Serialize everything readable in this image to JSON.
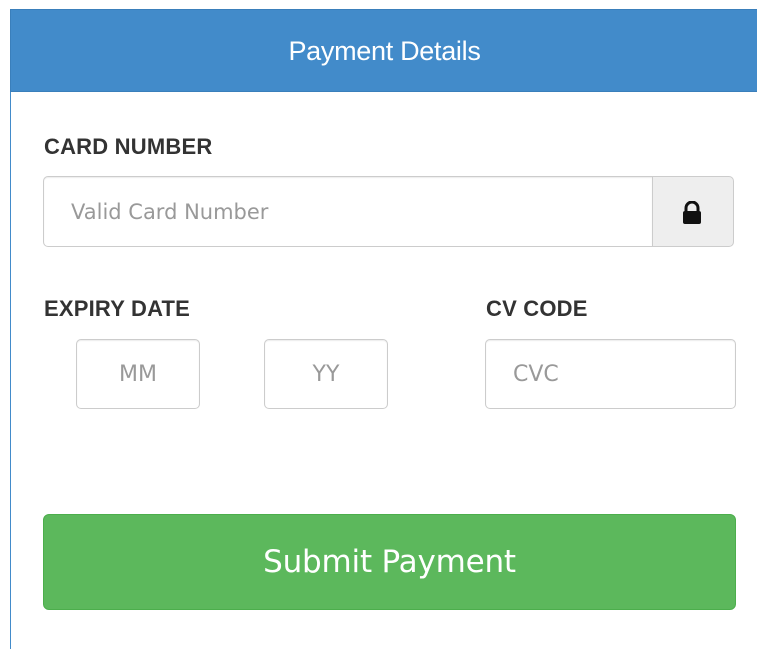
{
  "header": {
    "title": "Payment Details"
  },
  "card_number": {
    "label": "CARD NUMBER",
    "placeholder": "Valid Card Number",
    "value": "",
    "addon_icon": "lock-icon"
  },
  "expiry": {
    "label": "EXPIRY DATE",
    "month_placeholder": "MM",
    "year_placeholder": "YY"
  },
  "cv_code": {
    "label": "CV CODE",
    "placeholder": "CVC"
  },
  "submit": {
    "label": "Submit Payment"
  },
  "colors": {
    "header_bg": "#428bca",
    "submit_bg": "#5cb85c",
    "addon_bg": "#eeeeee",
    "label_text": "#333333",
    "placeholder_text": "#999999"
  }
}
